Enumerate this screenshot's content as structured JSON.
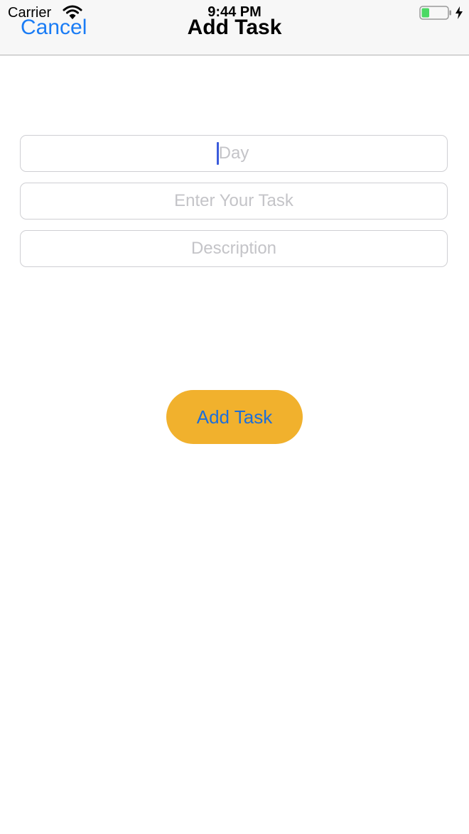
{
  "status_bar": {
    "carrier": "Carrier",
    "time": "9:44 PM",
    "icons": [
      "wifi-icon",
      "battery-icon",
      "charging-bolt-icon"
    ],
    "battery_level": 0.3,
    "battery_color": "#4cd964"
  },
  "nav_bar": {
    "cancel_label": "Cancel",
    "title": "Add Task",
    "accent_color": "#1a7cf5"
  },
  "form": {
    "day": {
      "value": "",
      "placeholder": "Day",
      "focused": true
    },
    "task": {
      "value": "",
      "placeholder": "Enter Your Task"
    },
    "description": {
      "value": "",
      "placeholder": "Description"
    }
  },
  "actions": {
    "add_task_label": "Add Task",
    "button_color": "#f1b12d",
    "label_color": "#1e6fd9"
  }
}
